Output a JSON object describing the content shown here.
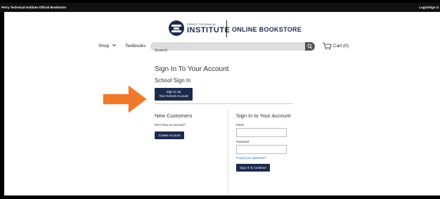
{
  "topbar": {
    "left_label": "Perry Technical Institute Official Bookstore",
    "right_label": "Login/Sign U"
  },
  "header": {
    "institution_small": "PERRY TECHNICAL",
    "institution_big": "INSTITUTE",
    "store_title": "ONLINE BOOKSTORE"
  },
  "nav": {
    "shop_label": "Shop",
    "textbooks_label": "Textbooks",
    "search_placeholder": "Search",
    "cart_label": "Cart (0)"
  },
  "signin": {
    "heading": "Sign In To Your Account",
    "school_heading": "School Sign In",
    "sso_line1": "Sign in via",
    "sso_line2": "Your School Account"
  },
  "new_customers": {
    "title": "New Customers",
    "prompt": "Don't have an account?",
    "create_label": "Create Account"
  },
  "account_signin": {
    "title": "Sign In to Your Account",
    "email_label": "Email",
    "password_label": "Password",
    "forgot_label": "Forgot your password?",
    "submit_label": "Sign In & Continue"
  },
  "colors": {
    "brand_navy": "#1c2a4c",
    "arrow_orange": "#f07a2a",
    "link_blue": "#2d6cbf"
  }
}
